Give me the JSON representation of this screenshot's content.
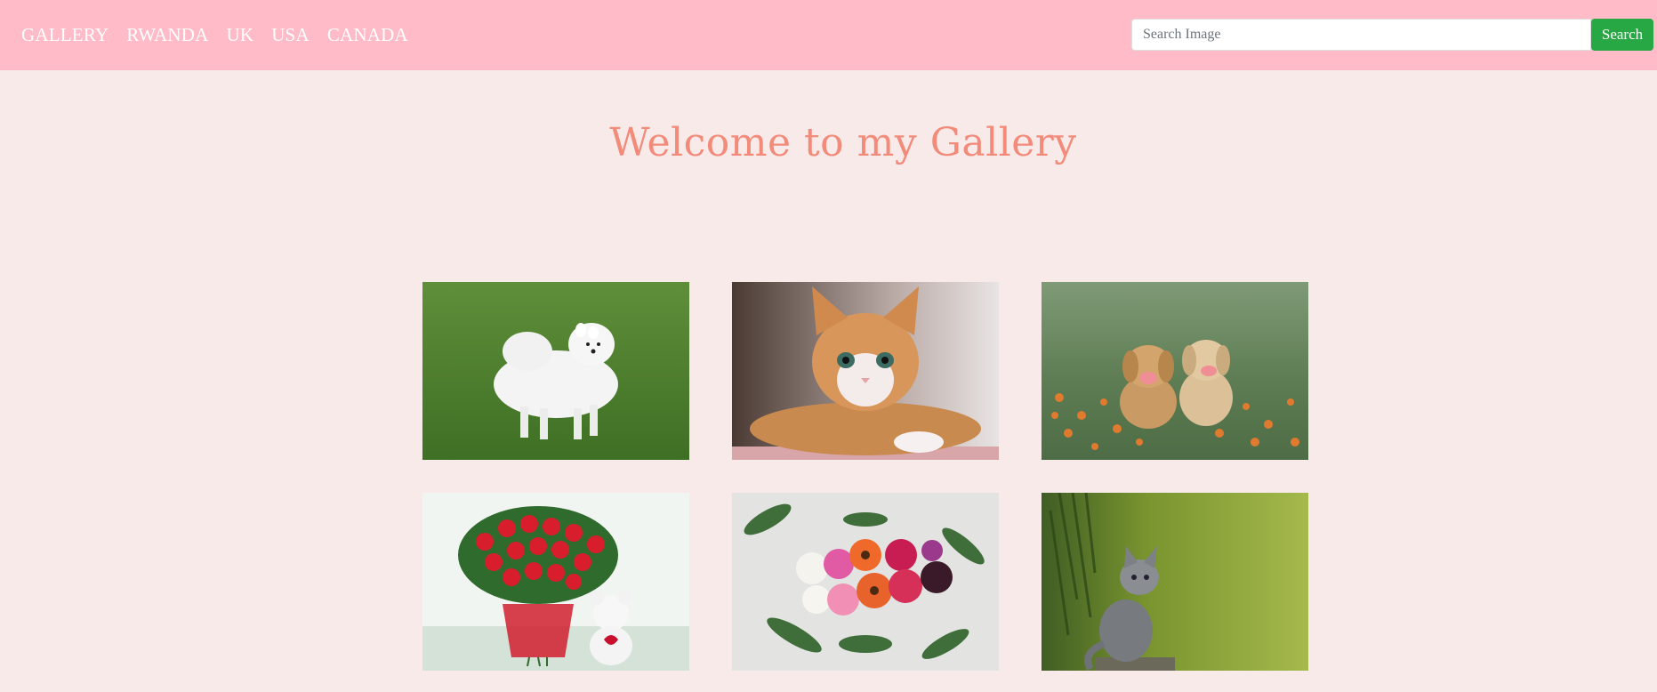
{
  "navbar": {
    "links": [
      "GALLERY",
      "RWANDA",
      "UK",
      "USA",
      "CANADA"
    ],
    "background": "#ffbbc7"
  },
  "search": {
    "placeholder": "Search Image",
    "value": "",
    "button_label": "Search",
    "button_color": "#28a745"
  },
  "main": {
    "title": "Welcome to my Gallery",
    "title_color": "#f28b7a",
    "background": "#f9eaea"
  }
}
